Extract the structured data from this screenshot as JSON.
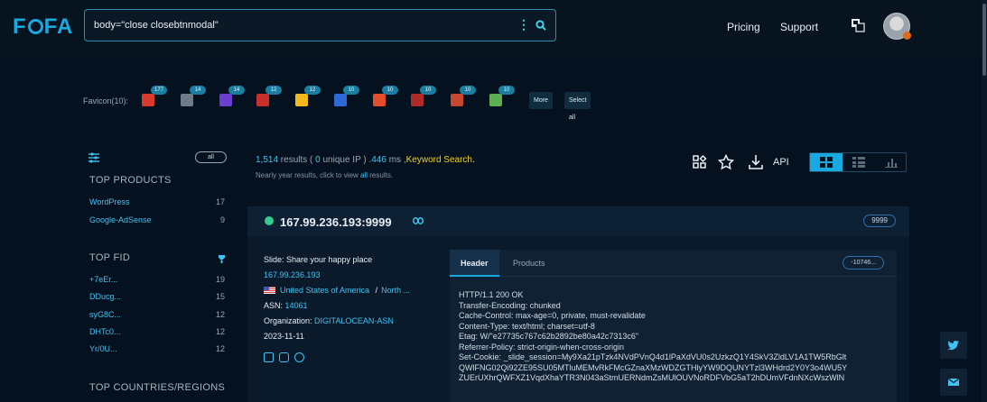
{
  "logo": "FOFA",
  "search": {
    "value": "body=\"close closebtnmodal\""
  },
  "nav": {
    "pricing": "Pricing",
    "support": "Support"
  },
  "favicons": {
    "label": "Favicon(10):",
    "items": [
      {
        "count": "177",
        "color": "#d93a2b"
      },
      {
        "count": "14",
        "color": "#6f7b88"
      },
      {
        "count": "14",
        "color": "#6b3fd0"
      },
      {
        "count": "12",
        "color": "#c8312b"
      },
      {
        "count": "12",
        "color": "#f4b91b"
      },
      {
        "count": "10",
        "color": "#2d6ad8"
      },
      {
        "count": "10",
        "color": "#e24d2b"
      },
      {
        "count": "10",
        "color": "#b12a2a"
      },
      {
        "count": "10",
        "color": "#c7472f"
      },
      {
        "count": "10",
        "color": "#5fae52"
      }
    ],
    "more": "More",
    "select_all": "Select all"
  },
  "sidebar": {
    "all": "all",
    "top_products": "TOP PRODUCTS",
    "products": [
      {
        "name": "WordPress",
        "count": "17"
      },
      {
        "name": "Google-AdSense",
        "count": "9"
      }
    ],
    "top_fid": "TOP FID",
    "fids": [
      {
        "name": "+7eEr...",
        "count": "19"
      },
      {
        "name": "DDucg...",
        "count": "15"
      },
      {
        "name": "syG8C...",
        "count": "12"
      },
      {
        "name": "DHTc0...",
        "count": "12"
      },
      {
        "name": "Yr/0U...",
        "count": "12"
      }
    ],
    "top_countries": "TOP COUNTRIES/REGIONS"
  },
  "summary": {
    "results": "1,514",
    "results_word": " results ( ",
    "unique": "0",
    "unique_word": " unique IP ) .",
    "ms": "446",
    "ms_word": " ms ,",
    "keyword": "Keyword Search",
    "period": ".",
    "sub_prefix": "Nearly year results, click to view ",
    "sub_all": "all",
    "sub_suffix": " results."
  },
  "toolbar": {
    "api": "API"
  },
  "result": {
    "ip_port": "167.99.236.193:9999",
    "port": "9999",
    "title": "Slide: Share your happy place",
    "ip": "167.99.236.193",
    "country": "United States of America",
    "sep": "/",
    "region": "North ...",
    "asn_label": "ASN:",
    "asn": "14061",
    "org_label": "Organization:",
    "org": "DIGITALOCEAN-ASN",
    "date": "2023-11-11",
    "tab_header": "Header",
    "tab_products": "Products",
    "hash": "-10746...",
    "headers": "HTTP/1.1 200 OK\nTransfer-Encoding: chunked\nCache-Control: max-age=0, private, must-revalidate\nContent-Type: text/html; charset=utf-8\nEtag: W/\"e27735c767c62b2892be80a42c7313c6\"\nReferrer-Policy: strict-origin-when-cross-origin\nSet-Cookie: _slide_session=My9Xa21pTzk4NVdPVnQ4d1lPaXdVU0s2UzkzQ1Y4SkV3ZldLV1A1TW5RbGlt\nQWlFNG02Qi92ZE95SU05MTluMEMvRkFMcGZnaXMzWDZGTHlyYW9DQUNYTzl3WHdrd2Y0Y3o4WU5Y\nZUErUXhrQWFXZ1VqdXhaYTR3N043aStmUERNdmZsMUlOUVNoRDFVbG5aT2hDUmVFdnNXcWszWlN"
  }
}
